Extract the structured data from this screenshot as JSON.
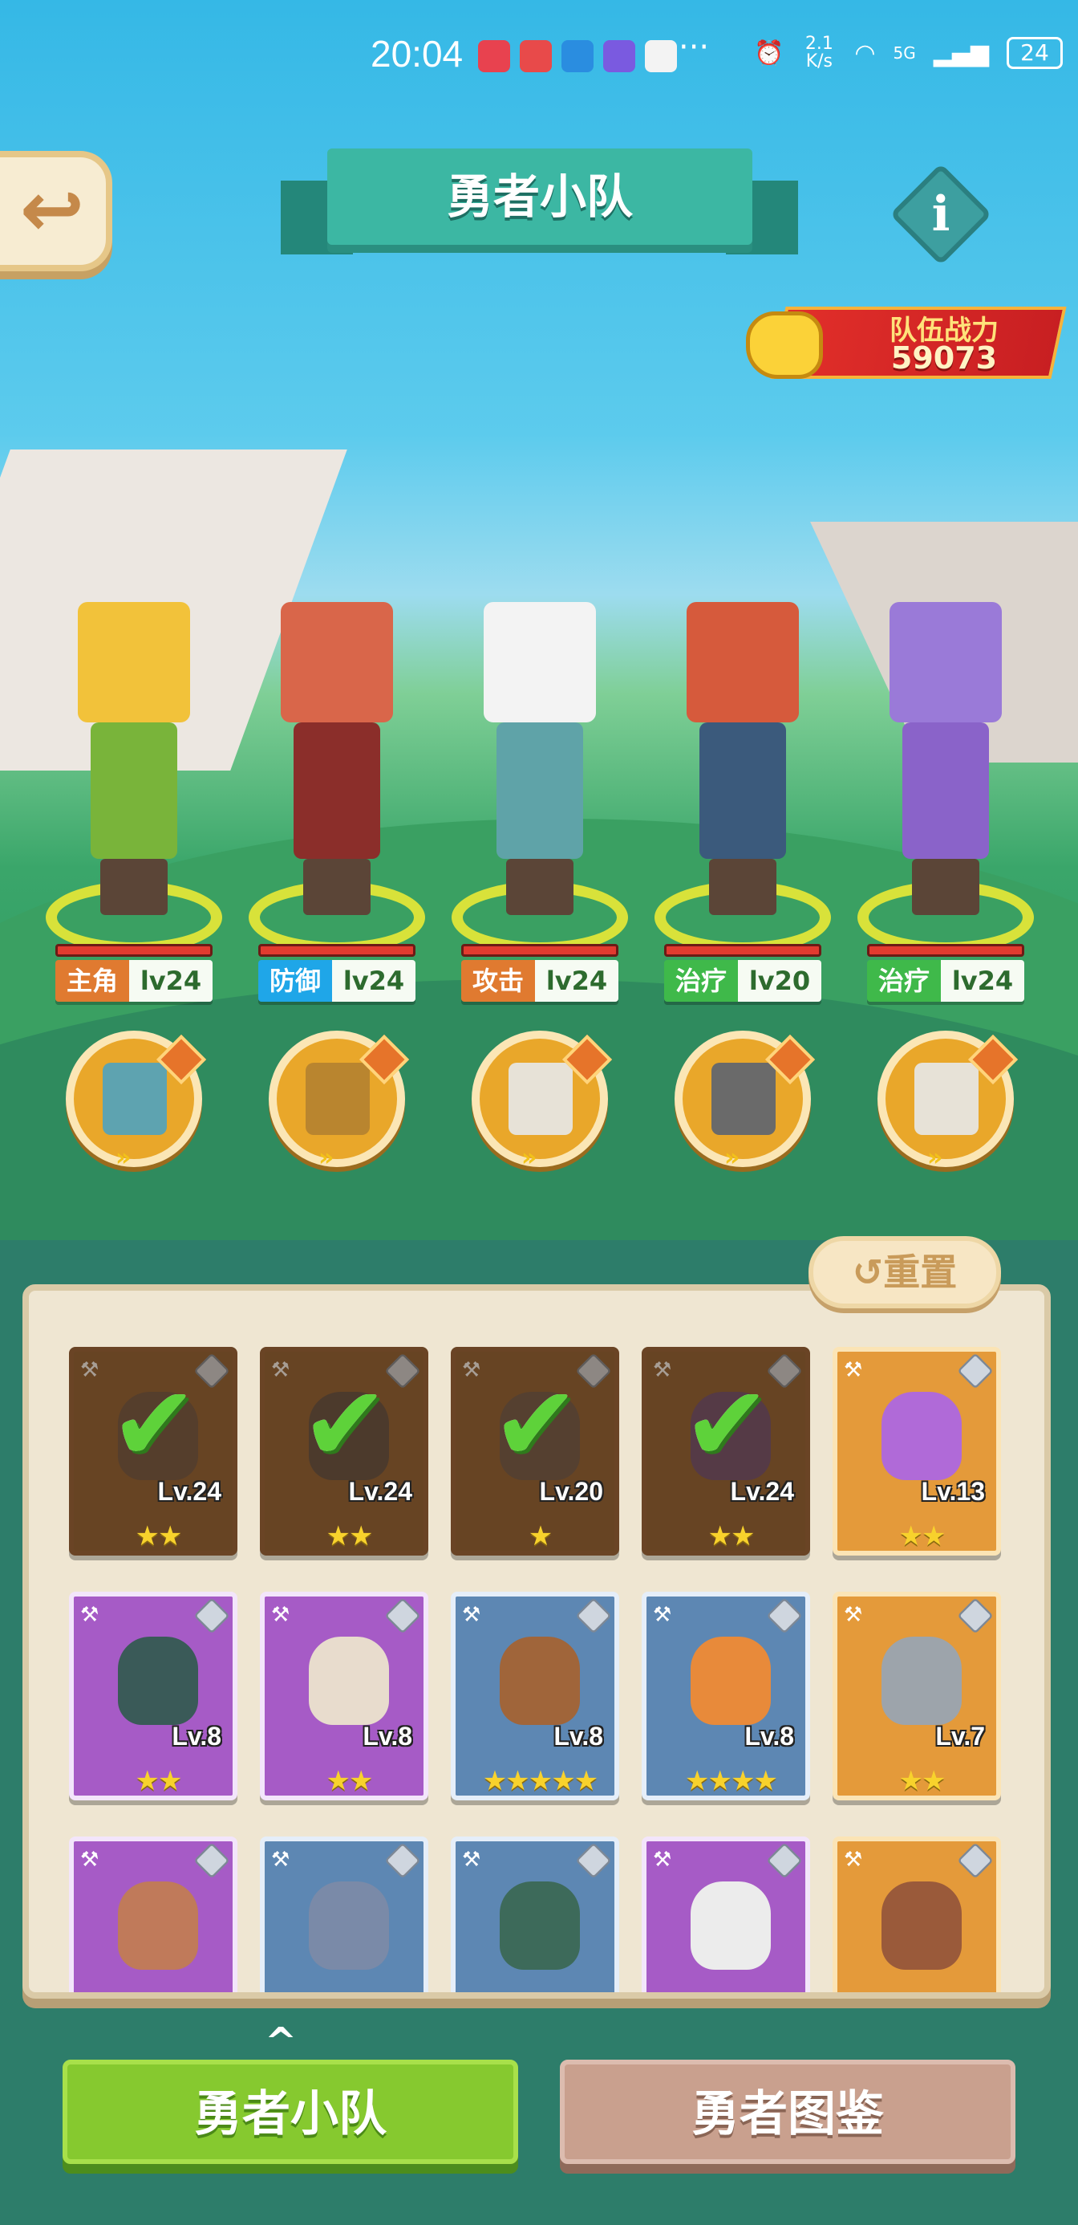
{
  "status_bar": {
    "time": "20:04",
    "dots": "···",
    "net_speed": "2.1 K/s",
    "signal": "5G",
    "battery": "24"
  },
  "header": {
    "title": "勇者小队",
    "back_icon": "back-arrow-icon",
    "info_label": "i"
  },
  "team_power": {
    "label": "队伍战力",
    "value": "59073"
  },
  "heroes": [
    {
      "role": "主角",
      "level": "lv24",
      "role_color": "#e07a30",
      "head_color": "#f2c23a",
      "body_color": "#79b43a",
      "pet_color": "#5ea3b0"
    },
    {
      "role": "防御",
      "level": "lv24",
      "role_color": "#1fa6e8",
      "head_color": "#d9664a",
      "body_color": "#8b2e2a",
      "pet_color": "#b9852f"
    },
    {
      "role": "攻击",
      "level": "lv24",
      "role_color": "#e07a30",
      "head_color": "#f3f3f3",
      "body_color": "#5fa3a8",
      "pet_color": "#e7e2d7"
    },
    {
      "role": "治疗",
      "level": "lv20",
      "role_color": "#3fb94a",
      "head_color": "#d65a3c",
      "body_color": "#3b5a7c",
      "pet_color": "#6a6a6a"
    },
    {
      "role": "治疗",
      "level": "lv24",
      "role_color": "#3fb94a",
      "head_color": "#9a7ad8",
      "body_color": "#8a63c9",
      "pet_color": "#e7e2d7"
    }
  ],
  "pet_arrows": "»",
  "reset_button": "↺重置",
  "roster": [
    {
      "level": "Lv.24",
      "stars": "★★",
      "frame": "c-brown",
      "used": true,
      "face": "#6a5040"
    },
    {
      "level": "Lv.24",
      "stars": "★★",
      "frame": "c-brown",
      "used": true,
      "face": "#5a4a40"
    },
    {
      "level": "Lv.20",
      "stars": "★",
      "frame": "c-brown",
      "used": true,
      "face": "#6a5548"
    },
    {
      "level": "Lv.24",
      "stars": "★★",
      "frame": "c-brown",
      "used": true,
      "face": "#6a4a70"
    },
    {
      "level": "Lv.13",
      "stars": "★★",
      "frame": "c-orange",
      "used": false,
      "face": "#b06ad8"
    },
    {
      "level": "Lv.8",
      "stars": "★★",
      "frame": "c-purple",
      "used": false,
      "face": "#3a5a58"
    },
    {
      "level": "Lv.8",
      "stars": "★★",
      "frame": "c-purple",
      "used": false,
      "face": "#e8dccd"
    },
    {
      "level": "Lv.8",
      "stars": "★★★★★",
      "frame": "c-blue",
      "used": false,
      "face": "#a0653a"
    },
    {
      "level": "Lv.8",
      "stars": "★★★★",
      "frame": "c-blue",
      "used": false,
      "face": "#e88a3a"
    },
    {
      "level": "Lv.7",
      "stars": "★★",
      "frame": "c-orange",
      "used": false,
      "face": "#9da4ab"
    },
    {
      "level": "",
      "stars": "",
      "frame": "c-purple",
      "used": false,
      "face": "#c07a5a"
    },
    {
      "level": "",
      "stars": "",
      "frame": "c-blue",
      "used": false,
      "face": "#7a8aa8"
    },
    {
      "level": "",
      "stars": "",
      "frame": "c-blue",
      "used": false,
      "face": "#3d6a5a"
    },
    {
      "level": "",
      "stars": "",
      "frame": "c-purple",
      "used": false,
      "face": "#ececec"
    },
    {
      "level": "",
      "stars": "",
      "frame": "c-orange",
      "used": false,
      "face": "#9a5a3a"
    }
  ],
  "check_mark": "✔",
  "bottom_tabs": {
    "chevron": "^",
    "team": "勇者小队",
    "guide": "勇者图鉴"
  }
}
